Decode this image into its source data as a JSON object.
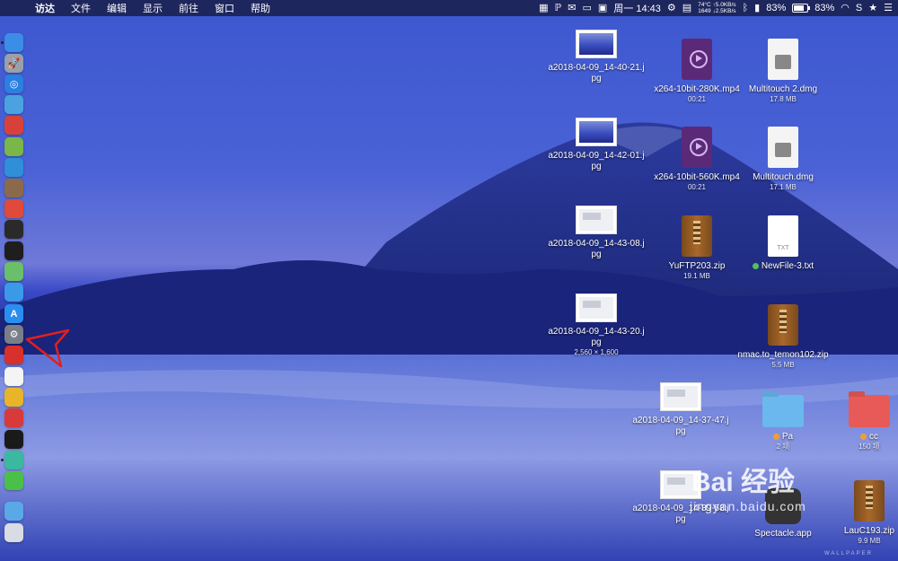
{
  "menubar": {
    "app_name": "访达",
    "items": [
      "文件",
      "编辑",
      "显示",
      "前往",
      "窗口",
      "帮助"
    ],
    "status": {
      "temperature": "74°C",
      "upload": "↑5.0KB/s",
      "rpm": "1649",
      "download": "↓2.5KB/s",
      "clock": "周一 14:43",
      "battery_1": "83%",
      "battery_2": "83%",
      "battery_level": 0.83
    }
  },
  "dock": {
    "items": [
      {
        "name": "finder",
        "color": "#3a8ee8",
        "glyph": ""
      },
      {
        "name": "launchpad",
        "color": "#9aa0aa",
        "glyph": "🚀"
      },
      {
        "name": "safari",
        "color": "#2a7fe0",
        "glyph": "◎"
      },
      {
        "name": "preview",
        "color": "#4aa3e0",
        "glyph": ""
      },
      {
        "name": "app-red",
        "color": "#d8413a",
        "glyph": ""
      },
      {
        "name": "android-studio",
        "color": "#7ab648",
        "glyph": ""
      },
      {
        "name": "app-blue",
        "color": "#2f8fd8",
        "glyph": ""
      },
      {
        "name": "app-brown",
        "color": "#8a6a4a",
        "glyph": ""
      },
      {
        "name": "app-red-2",
        "color": "#e04a3a",
        "glyph": ""
      },
      {
        "name": "activity-monitor",
        "color": "#2a2a2a",
        "glyph": ""
      },
      {
        "name": "terminal",
        "color": "#1e1e1e",
        "glyph": ""
      },
      {
        "name": "maps",
        "color": "#6ac06a",
        "glyph": ""
      },
      {
        "name": "siri",
        "color": "#3a9ae8",
        "glyph": ""
      },
      {
        "name": "app-store",
        "color": "#2a8ef0",
        "glyph": "A"
      },
      {
        "name": "system-preferences",
        "color": "#7a7e88",
        "glyph": "⚙"
      },
      {
        "name": "netease-music",
        "color": "#d8302a",
        "glyph": ""
      },
      {
        "name": "yandex-browser",
        "color": "#f4f4f4",
        "glyph": ""
      },
      {
        "name": "chrome",
        "color": "#e8b42a",
        "glyph": ""
      },
      {
        "name": "vivaldi",
        "color": "#d83a3a",
        "glyph": ""
      },
      {
        "name": "terminal-2",
        "color": "#1a1a1a",
        "glyph": ""
      },
      {
        "name": "app-teal",
        "color": "#3ab8a0",
        "glyph": ""
      },
      {
        "name": "wechat",
        "color": "#4ac04a",
        "glyph": ""
      },
      {
        "name": "downloads-folder",
        "color": "#5aa8e8",
        "glyph": ""
      },
      {
        "name": "trash",
        "color": "#d8dce4",
        "glyph": ""
      }
    ]
  },
  "desktop": {
    "items": [
      {
        "type": "screenshot",
        "label": "a2018-04-09_14-40-21.jpg",
        "sub": ""
      },
      {
        "type": "screenshot",
        "label": "a2018-04-09_14-42-01.jpg",
        "sub": ""
      },
      {
        "type": "screenshot-window",
        "label": "a2018-04-09_14-43-08.jpg",
        "sub": ""
      },
      {
        "type": "screenshot-window",
        "label": "a2018-04-09_14-43-20.jpg",
        "sub": "2,560 × 1,600"
      },
      {
        "type": "screenshot-window",
        "label": "a2018-04-09_14-37-47.jpg",
        "sub": ""
      },
      {
        "type": "screenshot-window",
        "label": "a2018-04-09_14-39-58.jpg",
        "sub": ""
      },
      {
        "type": "video",
        "label": "x264-10bit-280K.mp4",
        "sub": "00:21"
      },
      {
        "type": "video",
        "label": "x264-10bit-560K.mp4",
        "sub": "00:21"
      },
      {
        "type": "zip",
        "label": "YuFTP203.zip",
        "sub": "19.1 MB"
      },
      {
        "type": "dmg",
        "label": "Multitouch 2.dmg",
        "sub": "17.8 MB"
      },
      {
        "type": "dmg",
        "label": "Multitouch.dmg",
        "sub": "17.1 MB"
      },
      {
        "type": "txt",
        "label": "NewFile-3.txt",
        "sub": "",
        "icon_text": "TXT",
        "tag_color": "#52c15a"
      },
      {
        "type": "zip",
        "label": "nmac.to_temon102.zip",
        "sub": "5.5 MB"
      },
      {
        "type": "folder",
        "label": "Pa",
        "sub": "2 项",
        "color": "#6ab8ee",
        "tag_color": "#f0a030"
      },
      {
        "type": "folder",
        "label": "cc",
        "sub": "150 项",
        "color": "#e85a58",
        "tag_color": "#f0a030"
      },
      {
        "type": "app",
        "label": "Spectacle.app",
        "sub": ""
      },
      {
        "type": "zip",
        "label": "LauC193.zip",
        "sub": "9.9 MB"
      }
    ]
  },
  "watermark": {
    "main": "Bai  经验",
    "sub": "jingyan.baidu.com",
    "wallpaper": "WALLPAPER"
  },
  "colors": {
    "annotation_arrow": "#e02020"
  }
}
